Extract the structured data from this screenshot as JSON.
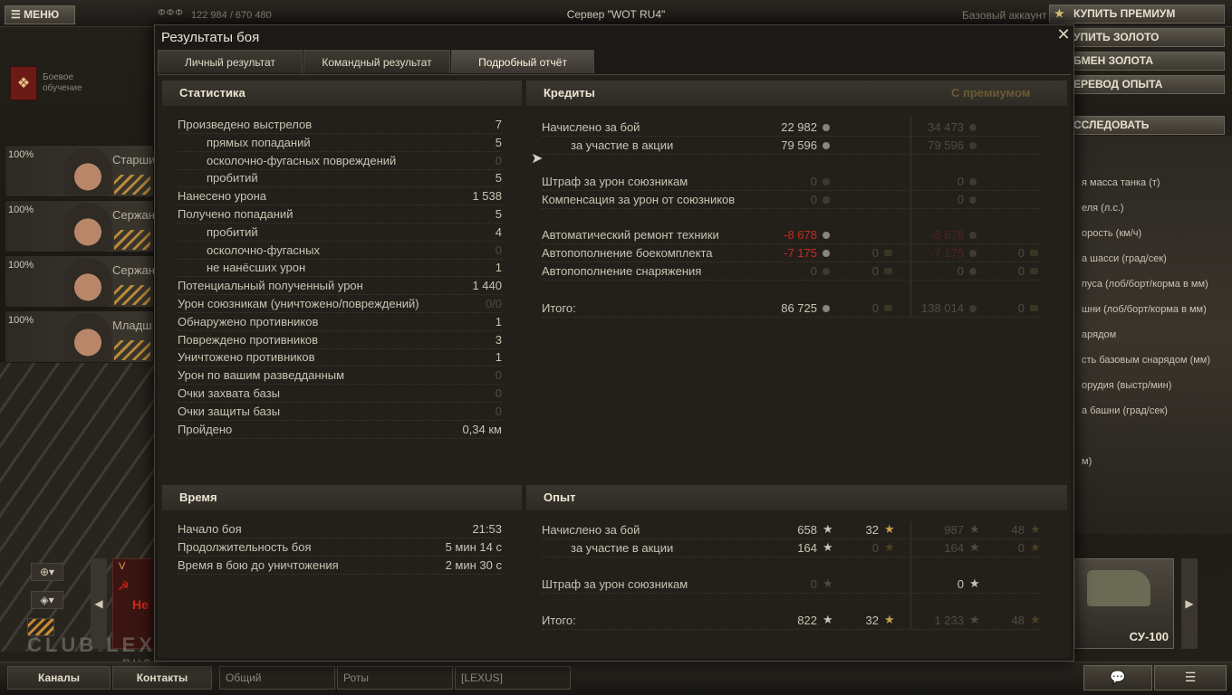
{
  "topbar": {
    "menu": "МЕНЮ",
    "resource_icon": "ФФФ",
    "resources": "122 984 / 670 480",
    "server": "Сервер \"WOT RU4\"",
    "account": "Базовый аккаунт",
    "buy_premium": "КУПИТЬ ПРЕМИУМ",
    "buy_gold": "УПИТЬ ЗОЛОТО",
    "exchange": "БМЕН ЗОЛОТА",
    "transfer": "ЕРЕВОД ОПЫТА",
    "research": "ССЛЕДОВАТЬ"
  },
  "training": {
    "label": "Боевое обучение"
  },
  "crew": [
    {
      "pct": "100%",
      "role": "Старши"
    },
    {
      "pct": "100%",
      "role": "Сержан"
    },
    {
      "pct": "100%",
      "role": "Сержан"
    },
    {
      "pct": "100%",
      "role": "Младш"
    }
  ],
  "specs": [
    "я масса танка (т)",
    "еля (л.с.)",
    "орость (км/ч)",
    "а шасси (град/сек)",
    "пуса (лоб/борт/корма в мм)",
    "шни (лоб/борт/корма в мм)",
    "арядом",
    "сть базовым снарядом (мм)",
    "орудия (выстр/мин)",
    "а башни (град/сек)",
    "",
    "м)"
  ],
  "vehicle": {
    "name": "СУ-100"
  },
  "left_card": {
    "star": "V",
    "text": "Не",
    "sickle": "☭"
  },
  "watermark": {
    "main": "CLUB LEXUS",
    "sub": "RUSSIA"
  },
  "bottom": {
    "channels": "Каналы",
    "contacts": "Контакты",
    "general": "Общий",
    "companies": "Роты",
    "lexus": "[LEXUS]"
  },
  "dialog": {
    "title": "Результаты боя",
    "tabs": [
      "Личный результат",
      "Командный результат",
      "Подробный отчёт"
    ],
    "stats": {
      "heading": "Статистика",
      "rows": [
        {
          "label": "Произведено выстрелов",
          "value": "7",
          "ind": false,
          "dim": false
        },
        {
          "label": "прямых попаданий",
          "value": "5",
          "ind": true,
          "dim": false
        },
        {
          "label": "осколочно-фугасных повреждений",
          "value": "0",
          "ind": true,
          "dim": true
        },
        {
          "label": "пробитий",
          "value": "5",
          "ind": true,
          "dim": false
        },
        {
          "label": "Нанесено урона",
          "value": "1 538",
          "ind": false,
          "dim": false
        },
        {
          "label": "Получено попаданий",
          "value": "5",
          "ind": false,
          "dim": false
        },
        {
          "label": "пробитий",
          "value": "4",
          "ind": true,
          "dim": false
        },
        {
          "label": "осколочно-фугасных",
          "value": "0",
          "ind": true,
          "dim": true
        },
        {
          "label": "не нанёсших урон",
          "value": "1",
          "ind": true,
          "dim": false
        },
        {
          "label": "Потенциальный полученный урон",
          "value": "1 440",
          "ind": false,
          "dim": false
        },
        {
          "label": "Урон союзникам (уничтожено/повреждений)",
          "value": "0/0",
          "ind": false,
          "dim": true
        },
        {
          "label": "Обнаружено противников",
          "value": "1",
          "ind": false,
          "dim": false
        },
        {
          "label": "Повреждено противников",
          "value": "3",
          "ind": false,
          "dim": false
        },
        {
          "label": "Уничтожено противников",
          "value": "1",
          "ind": false,
          "dim": false
        },
        {
          "label": "Урон по вашим разведданным",
          "value": "0",
          "ind": false,
          "dim": true
        },
        {
          "label": "Очки захвата базы",
          "value": "0",
          "ind": false,
          "dim": true
        },
        {
          "label": "Очки защиты базы",
          "value": "0",
          "ind": false,
          "dim": true
        },
        {
          "label": "Пройдено",
          "value": "0,34 км",
          "ind": false,
          "dim": false
        }
      ]
    },
    "credits": {
      "heading": "Кредиты",
      "premium_heading": "С премиумом",
      "rows": [
        {
          "label": "Начислено за бой",
          "ind": false,
          "b": "22 982",
          "bst": "n",
          "g": "",
          "gst": "",
          "p": "34 473",
          "pst": "d",
          "pg": "",
          "pgst": ""
        },
        {
          "label": "за участие в акции",
          "ind": true,
          "b": "79 596",
          "bst": "n",
          "g": "",
          "gst": "",
          "p": "79 596",
          "pst": "d",
          "pg": "",
          "pgst": ""
        },
        {
          "label": "Штраф за урон союзникам",
          "ind": false,
          "b": "0",
          "bst": "d",
          "g": "",
          "gst": "",
          "p": "0",
          "pst": "d",
          "pg": "",
          "pgst": ""
        },
        {
          "label": "Компенсация за урон от союзников",
          "ind": false,
          "b": "0",
          "bst": "d",
          "g": "",
          "gst": "",
          "p": "0",
          "pst": "d",
          "pg": "",
          "pgst": ""
        },
        {
          "label": "Автоматический ремонт техники",
          "ind": false,
          "b": "-8 678",
          "bst": "r",
          "g": "",
          "gst": "",
          "p": "-8 678",
          "pst": "dr",
          "pg": "",
          "pgst": ""
        },
        {
          "label": "Автопополнение боекомплекта",
          "ind": false,
          "b": "-7 175",
          "bst": "r",
          "g": "0",
          "gst": "d",
          "p": "-7 175",
          "pst": "dr",
          "pg": "0",
          "pgst": "d"
        },
        {
          "label": "Автопополнение снаряжения",
          "ind": false,
          "b": "0",
          "bst": "d",
          "g": "0",
          "gst": "d",
          "p": "0",
          "pst": "d",
          "pg": "0",
          "pgst": "d"
        },
        {
          "label": "Итого:",
          "ind": false,
          "b": "86 725",
          "bst": "n",
          "g": "0",
          "gst": "d",
          "p": "138 014",
          "pst": "d",
          "pg": "0",
          "pgst": "d"
        }
      ]
    },
    "time": {
      "heading": "Время",
      "rows": [
        {
          "label": "Начало боя",
          "value": "21:53"
        },
        {
          "label": "Продолжительность боя",
          "value": "5 мин 14 с"
        },
        {
          "label": "Время в бою до уничтожения",
          "value": "2 мин 30 с"
        }
      ]
    },
    "xp": {
      "heading": "Опыт",
      "rows": [
        {
          "label": "Начислено за бой",
          "ind": false,
          "b": "658",
          "bst": "n",
          "g": "32",
          "gst": "n",
          "p": "987",
          "pst": "d",
          "pg": "48",
          "pgst": "d"
        },
        {
          "label": "за участие в акции",
          "ind": true,
          "b": "164",
          "bst": "n",
          "g": "0",
          "gst": "d",
          "p": "164",
          "pst": "d",
          "pg": "0",
          "pgst": "d"
        },
        {
          "label": "Штраф за урон союзникам",
          "ind": false,
          "b": "0",
          "bst": "d",
          "g": "",
          "gst": "",
          "p": "0",
          "pst": "n",
          "pg": "",
          "pgst": ""
        },
        {
          "label": "Итого:",
          "ind": false,
          "b": "822",
          "bst": "n",
          "g": "32",
          "gst": "n",
          "p": "1 233",
          "pst": "d",
          "pg": "48",
          "pgst": "d"
        }
      ]
    }
  }
}
